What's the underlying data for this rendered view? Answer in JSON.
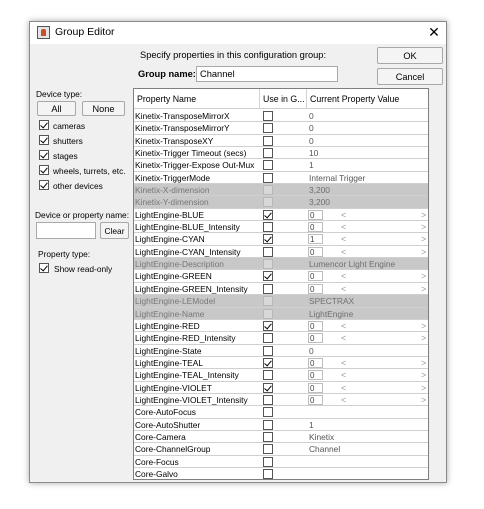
{
  "window": {
    "title": "Group Editor",
    "close_glyph": "✕"
  },
  "header": {
    "instruction": "Specify properties in this configuration group:",
    "group_name_label": "Group name:",
    "group_name_value": "Channel",
    "ok_label": "OK",
    "cancel_label": "Cancel"
  },
  "filters": {
    "device_type_label": "Device type:",
    "all_label": "All",
    "none_label": "None",
    "types": [
      {
        "label": "cameras",
        "checked": true
      },
      {
        "label": "shutters",
        "checked": true
      },
      {
        "label": "stages",
        "checked": true
      },
      {
        "label": "wheels, turrets, etc.",
        "checked": true
      },
      {
        "label": "other devices",
        "checked": true
      }
    ],
    "search_label": "Device or property name:",
    "search_value": "",
    "clear_label": "Clear",
    "property_type_label": "Property type:",
    "show_readonly_label": "Show read-only",
    "show_readonly_checked": true
  },
  "table": {
    "columns": [
      "Property Name",
      "Use in G...",
      "Current Property Value"
    ],
    "rows": [
      {
        "name": "Kinetix-TransposeMirrorX",
        "use": false,
        "value": "0",
        "kind": "plain",
        "readonly": false
      },
      {
        "name": "Kinetix-TransposeMirrorY",
        "use": false,
        "value": "0",
        "kind": "plain",
        "readonly": false
      },
      {
        "name": "Kinetix-TransposeXY",
        "use": false,
        "value": "0",
        "kind": "plain",
        "readonly": false
      },
      {
        "name": "Kinetix-Trigger Timeout (secs)",
        "use": false,
        "value": "10",
        "kind": "plain",
        "readonly": false
      },
      {
        "name": "Kinetix-Trigger-Expose Out-Mux",
        "use": false,
        "value": "1",
        "kind": "plain",
        "readonly": false
      },
      {
        "name": "Kinetix-TriggerMode",
        "use": false,
        "value": "Internal Trigger",
        "kind": "plain",
        "readonly": false
      },
      {
        "name": "Kinetix-X-dimension",
        "use": false,
        "value": "3,200",
        "kind": "plain",
        "readonly": true
      },
      {
        "name": "Kinetix-Y-dimension",
        "use": false,
        "value": "3,200",
        "kind": "plain",
        "readonly": true
      },
      {
        "name": "LightEngine-BLUE",
        "use": true,
        "value": "0",
        "kind": "slider",
        "readonly": false
      },
      {
        "name": "LightEngine-BLUE_Intensity",
        "use": false,
        "value": "0",
        "kind": "slider",
        "readonly": false
      },
      {
        "name": "LightEngine-CYAN",
        "use": true,
        "value": "1",
        "kind": "slider",
        "readonly": false
      },
      {
        "name": "LightEngine-CYAN_Intensity",
        "use": false,
        "value": "0",
        "kind": "slider",
        "readonly": false
      },
      {
        "name": "LightEngine-Description",
        "use": false,
        "value": "Lumencor Light Engine",
        "kind": "plain",
        "readonly": true
      },
      {
        "name": "LightEngine-GREEN",
        "use": true,
        "value": "0",
        "kind": "slider",
        "readonly": false
      },
      {
        "name": "LightEngine-GREEN_Intensity",
        "use": false,
        "value": "0",
        "kind": "slider",
        "readonly": false
      },
      {
        "name": "LightEngine-LEModel",
        "use": false,
        "value": "SPECTRAX",
        "kind": "plain",
        "readonly": true
      },
      {
        "name": "LightEngine-Name",
        "use": false,
        "value": "LightEngine",
        "kind": "plain",
        "readonly": true
      },
      {
        "name": "LightEngine-RED",
        "use": true,
        "value": "0",
        "kind": "slider",
        "readonly": false
      },
      {
        "name": "LightEngine-RED_Intensity",
        "use": false,
        "value": "0",
        "kind": "slider",
        "readonly": false
      },
      {
        "name": "LightEngine-State",
        "use": false,
        "value": "0",
        "kind": "plain",
        "readonly": false
      },
      {
        "name": "LightEngine-TEAL",
        "use": true,
        "value": "0",
        "kind": "slider",
        "readonly": false
      },
      {
        "name": "LightEngine-TEAL_Intensity",
        "use": false,
        "value": "0",
        "kind": "slider",
        "readonly": false
      },
      {
        "name": "LightEngine-VIOLET",
        "use": true,
        "value": "0",
        "kind": "slider",
        "readonly": false
      },
      {
        "name": "LightEngine-VIOLET_Intensity",
        "use": false,
        "value": "0",
        "kind": "slider",
        "readonly": false
      },
      {
        "name": "Core-AutoFocus",
        "use": false,
        "value": "",
        "kind": "plain",
        "readonly": false
      },
      {
        "name": "Core-AutoShutter",
        "use": false,
        "value": "1",
        "kind": "plain",
        "readonly": false
      },
      {
        "name": "Core-Camera",
        "use": false,
        "value": "Kinetix",
        "kind": "plain",
        "readonly": false
      },
      {
        "name": "Core-ChannelGroup",
        "use": false,
        "value": "Channel",
        "kind": "plain",
        "readonly": false
      },
      {
        "name": "Core-Focus",
        "use": false,
        "value": "",
        "kind": "plain",
        "readonly": false
      },
      {
        "name": "Core-Galvo",
        "use": false,
        "value": "",
        "kind": "plain",
        "readonly": false
      }
    ]
  },
  "icons": {
    "slider_left": "<",
    "slider_right": ">",
    "scroll_up": "▲",
    "scroll_down": "▼"
  }
}
